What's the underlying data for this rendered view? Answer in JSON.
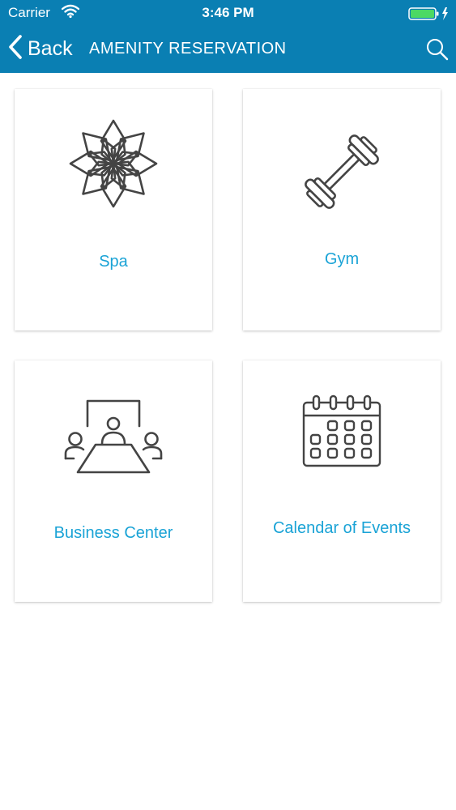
{
  "status_bar": {
    "carrier": "Carrier",
    "time": "3:46 PM",
    "battery_color": "#4cd964"
  },
  "nav": {
    "back_label": "Back",
    "title": "AMENITY RESERVATION",
    "search_icon": "search-icon",
    "back_icon": "chevron-left-icon",
    "background_color": "#0a7fb3"
  },
  "amenities": [
    {
      "label": "Spa",
      "icon": "lotus-icon"
    },
    {
      "label": "Gym",
      "icon": "dumbbell-icon"
    },
    {
      "label": "Business Center",
      "icon": "conference-table-icon"
    },
    {
      "label": "Calendar of Events",
      "icon": "calendar-icon"
    }
  ],
  "accent_color": "#1aa3d6"
}
